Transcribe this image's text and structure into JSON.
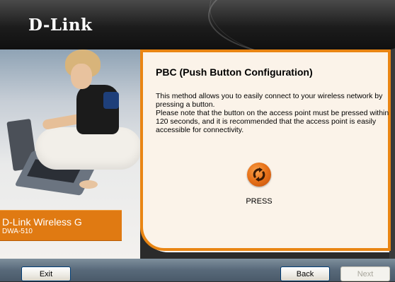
{
  "header": {
    "logo_text": "D-Link"
  },
  "sidebar": {
    "product_name": "D-Link Wireless G",
    "product_model": "DWA-510"
  },
  "main": {
    "title": "PBC (Push Button Configuration)",
    "description": "This method allows you to easily connect to your wireless network by pressing a button.\nPlease note that the button on the access point must be pressed within 120 seconds, and it is recommended that the access point is easily accessible for connectivity.",
    "press_icon": "wps-arrows-icon",
    "press_label": "PRESS"
  },
  "footer": {
    "exit_label": "Exit",
    "back_label": "Back",
    "next_label": "Next",
    "next_disabled": true
  },
  "colors": {
    "accent": "#e98513",
    "panel_bg": "#fbf3e9",
    "header_bg": "#1c1c1c",
    "bottom_bar": "#58697a"
  }
}
